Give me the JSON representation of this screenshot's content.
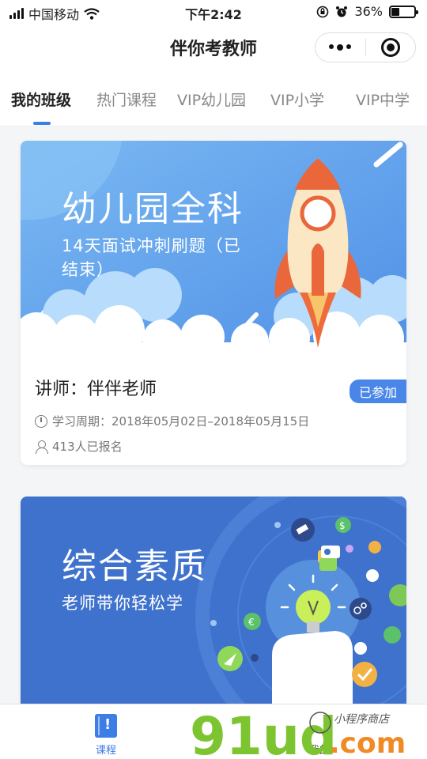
{
  "status_bar": {
    "carrier": "中国移动",
    "time": "下午2:42",
    "battery": "36%",
    "battery_level": 0.36
  },
  "navbar": {
    "title": "伴你考教师"
  },
  "tabs": [
    {
      "label": "我的班级",
      "active": true
    },
    {
      "label": "热门课程",
      "active": false
    },
    {
      "label": "VIP幼儿园",
      "active": false
    },
    {
      "label": "VIP小学",
      "active": false
    },
    {
      "label": "VIP中学",
      "active": false
    }
  ],
  "courses": [
    {
      "banner_title": "幼儿园全科",
      "banner_subtitle_1": "14天面试冲刺刷题（已",
      "banner_subtitle_2": "结束）",
      "lecturer": "讲师：伴伴老师",
      "badge": "已参加",
      "period": "学习周期：2018年05月02日–2018年05月15日",
      "enrolled": "413人已报名"
    },
    {
      "banner_title": "综合素质",
      "banner_subtitle": "老师带你轻松学"
    }
  ],
  "tabbar": {
    "course_label": "课程",
    "mine_label": "我的"
  },
  "watermark": {
    "brand": "91ud.com",
    "tagline": "小程序商店"
  },
  "colors": {
    "accent": "#3c7de6",
    "banner1_bg": "#5a9be8",
    "banner2_bg": "#3f72cc"
  }
}
